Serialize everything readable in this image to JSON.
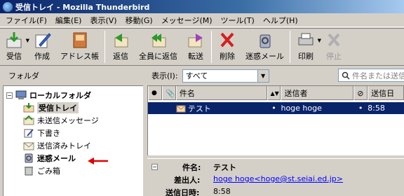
{
  "window": {
    "title": "受信トレイ - Mozilla Thunderbird"
  },
  "menu": [
    "ファイル(F)",
    "編集(E)",
    "表示(V)",
    "移動(G)",
    "メッセージ(M)",
    "ツール(T)",
    "ヘルプ(H)"
  ],
  "toolbar": {
    "receive": "受信",
    "compose": "作成",
    "addressbook": "アドレス帳",
    "reply": "返信",
    "replyall": "全員に返信",
    "forward": "転送",
    "delete": "削除",
    "junk": "迷惑メール",
    "print": "印刷",
    "stop": "停止"
  },
  "folders": {
    "header": "フォルダ",
    "account": "ローカルフォルダ",
    "items": [
      "受信トレイ",
      "未送信メッセージ",
      "下書き",
      "送信済みトレイ",
      "迷惑メール",
      "ごみ箱"
    ]
  },
  "view": {
    "label": "表示(I):",
    "selected": "すべて",
    "search_placeholder": "件名または送信"
  },
  "columns": {
    "subject": "件名",
    "sender": "送信者",
    "date": "送信日"
  },
  "message": {
    "subject": "テスト",
    "sender": "hoge hoge",
    "date": "8:58"
  },
  "preview": {
    "subject_label": "件名:",
    "subject": "テスト",
    "from_label": "差出人:",
    "from": "hoge hoge<hoge@st.seiai.ed.jp>",
    "date_label": "送信日時:",
    "date": "8:58"
  },
  "colors": {
    "selection": "#0a246a",
    "annotation_arrow": "#e00000"
  }
}
